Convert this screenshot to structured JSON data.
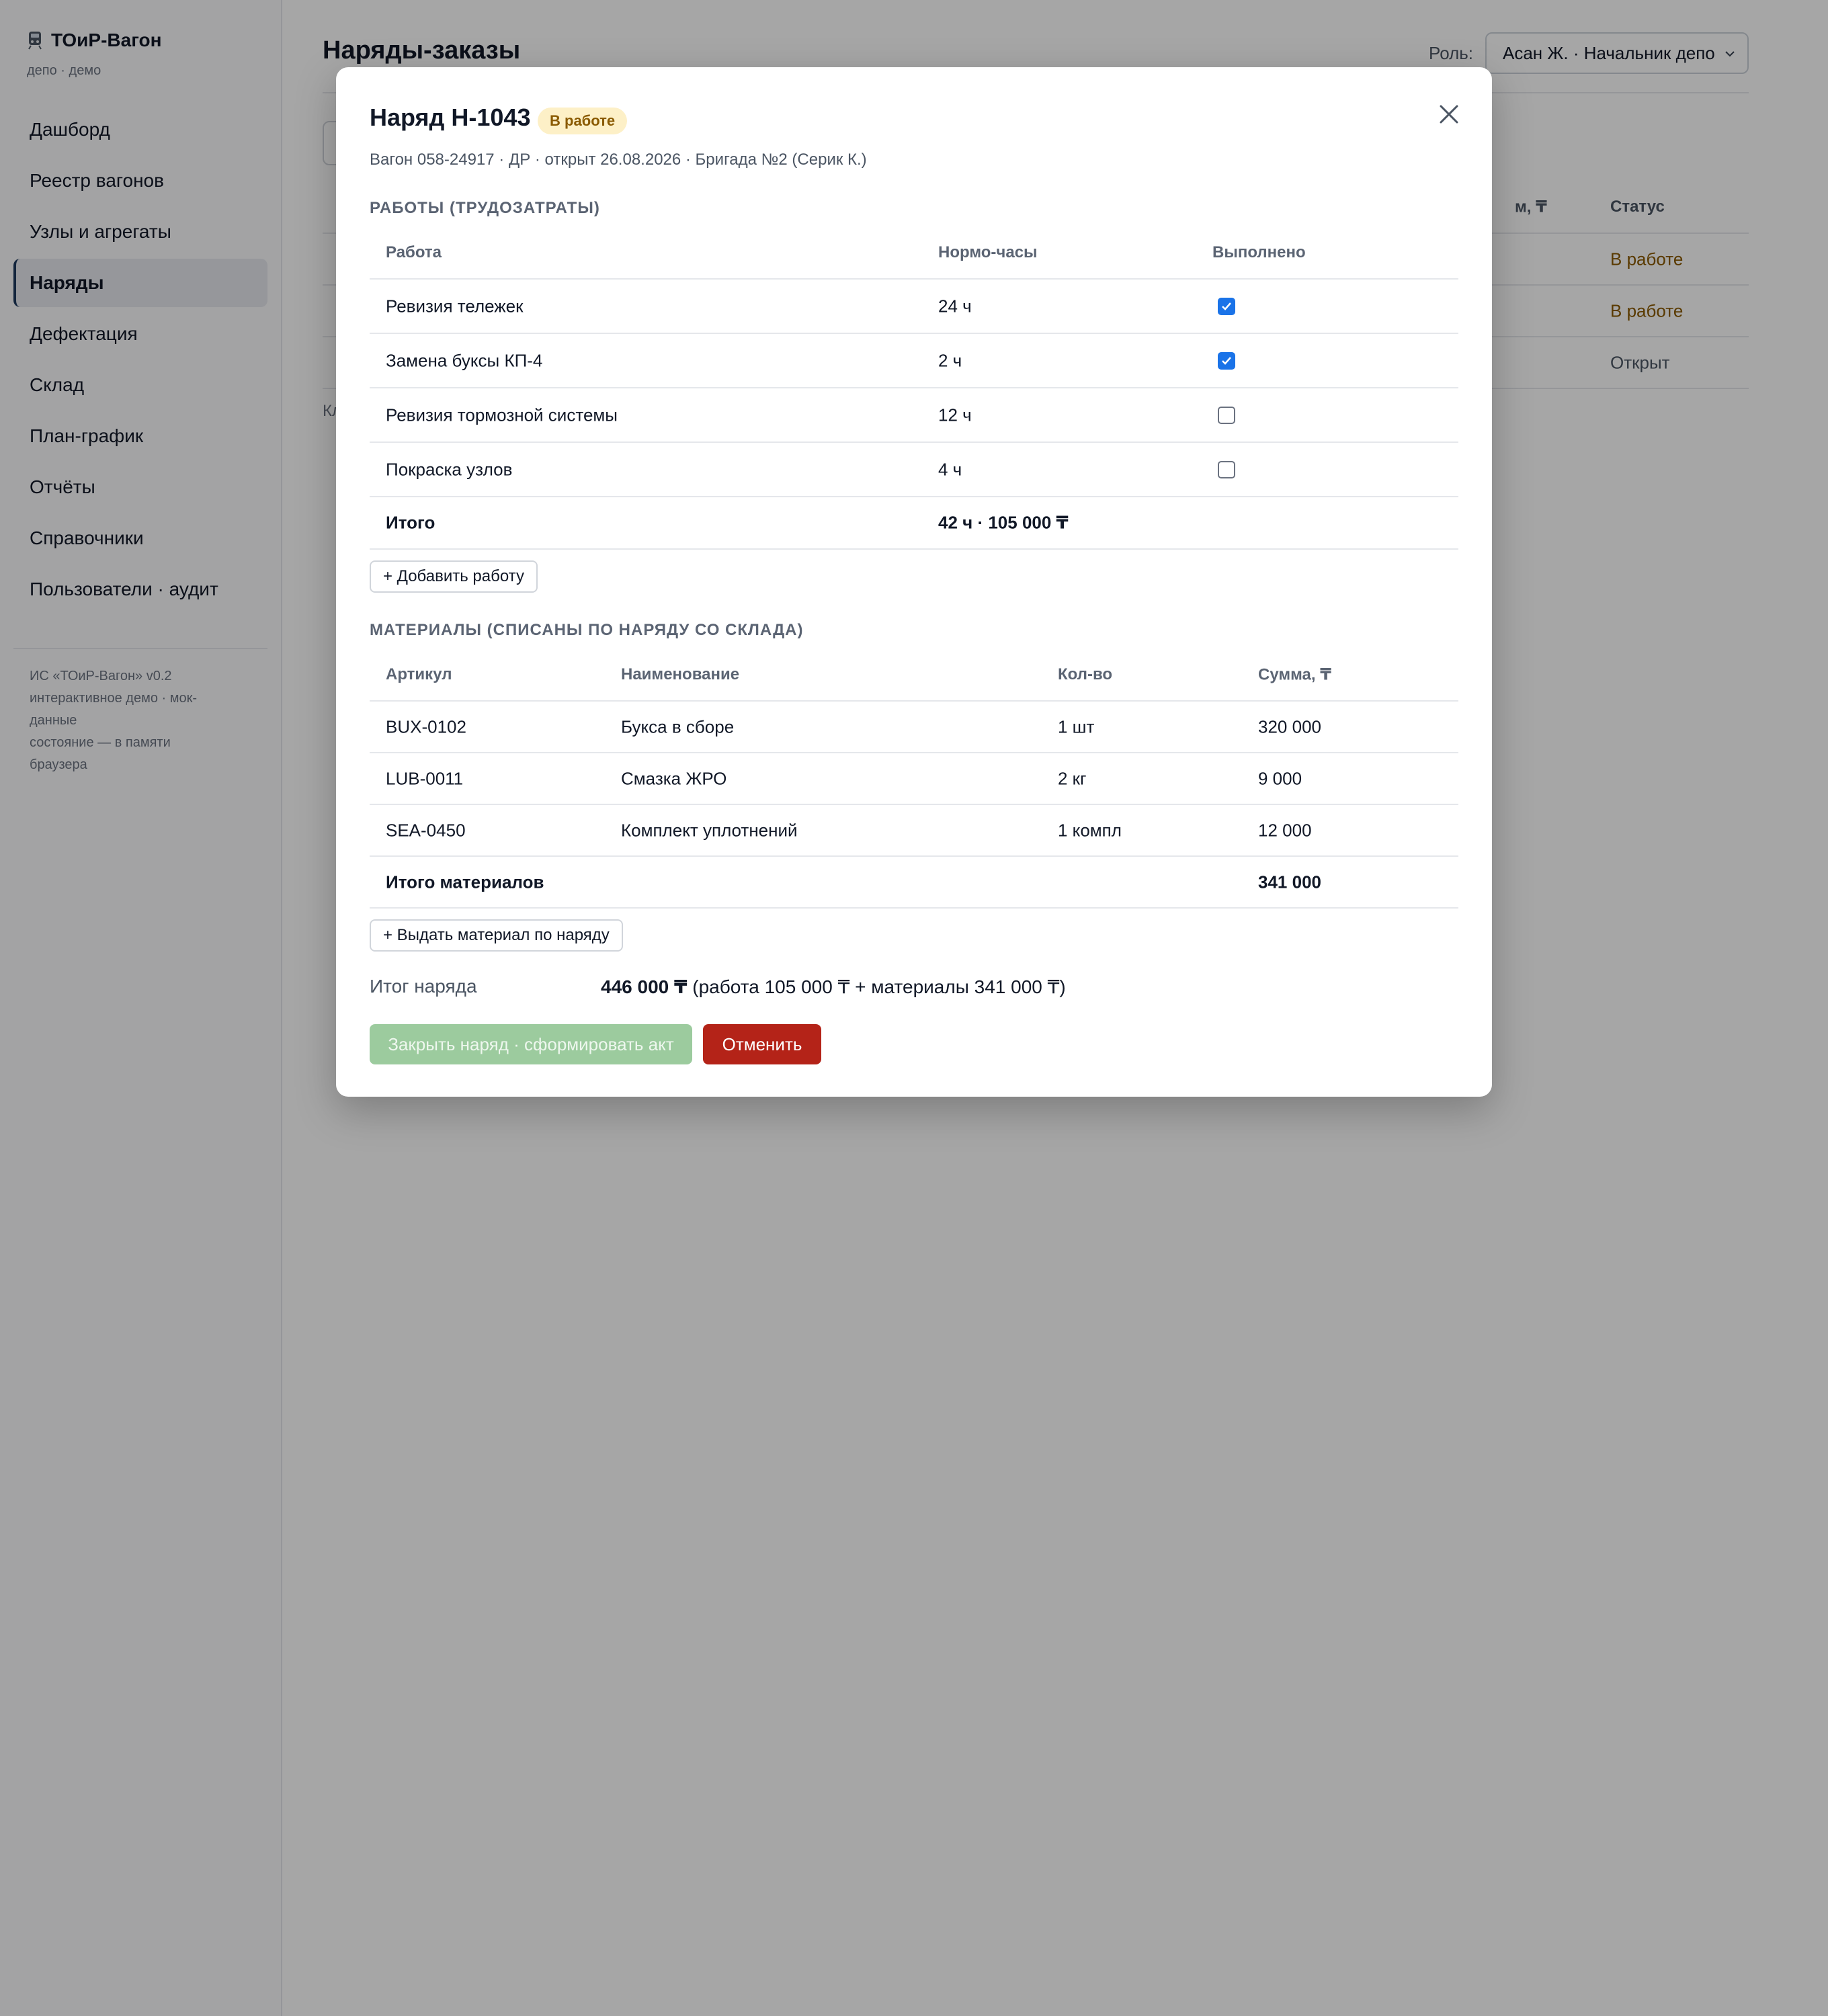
{
  "app": {
    "title": "ТОиР-Вагон",
    "subtitle": "депо · демо"
  },
  "sidebar": {
    "items": [
      {
        "label": "Дашборд",
        "active": false
      },
      {
        "label": "Реестр вагонов",
        "active": false
      },
      {
        "label": "Узлы и агрегаты",
        "active": false
      },
      {
        "label": "Наряды",
        "active": true
      },
      {
        "label": "Дефектация",
        "active": false
      },
      {
        "label": "Склад",
        "active": false
      },
      {
        "label": "План-график",
        "active": false
      },
      {
        "label": "Отчёты",
        "active": false
      },
      {
        "label": "Справочники",
        "active": false
      },
      {
        "label": "Пользователи · аудит",
        "active": false
      }
    ],
    "footer_lines": [
      "ИС «ТОиР-Вагон» v0.2",
      "интерактивное демо · мок-",
      "данные",
      "состояние — в памяти",
      "браузера"
    ]
  },
  "header": {
    "page_title": "Наряды-заказы",
    "role_label": "Роль:",
    "role_value": "Асан Ж. · Начальник депо"
  },
  "background_table": {
    "headers": {
      "sum_partial": "м, ₸",
      "status": "Статус"
    },
    "statuses": [
      "В работе",
      "В работе",
      "Открыт"
    ],
    "status_colors": {
      "in_progress": "#8a5a00",
      "open": "#4b5563"
    },
    "footnote_partial": "Кл"
  },
  "modal": {
    "title": "Наряд Н-1043",
    "status_badge": "В работе",
    "subtitle": "Вагон 058-24917 · ДР · открыт 26.08.2026 · Бригада №2 (Серик К.)",
    "works": {
      "section_title": "РАБОТЫ (ТРУДОЗАТРАТЫ)",
      "columns": [
        "Работа",
        "Нормо-часы",
        "Выполнено"
      ],
      "rows": [
        {
          "name": "Ревизия тележек",
          "hours": "24 ч",
          "done": true
        },
        {
          "name": "Замена буксы КП-4",
          "hours": "2 ч",
          "done": true
        },
        {
          "name": "Ревизия тормозной системы",
          "hours": "12 ч",
          "done": false
        },
        {
          "name": "Покраска узлов",
          "hours": "4 ч",
          "done": false
        }
      ],
      "total_label": "Итого",
      "total_value": "42 ч · 105 000 ₸",
      "add_button": "+ Добавить работу"
    },
    "materials": {
      "section_title": "МАТЕРИАЛЫ (СПИСАНЫ ПО НАРЯДУ СО СКЛАДА)",
      "columns": [
        "Артикул",
        "Наименование",
        "Кол-во",
        "Сумма, ₸"
      ],
      "rows": [
        {
          "sku": "BUX-0102",
          "name": "Букса в сборе",
          "qty": "1 шт",
          "sum": "320 000"
        },
        {
          "sku": "LUB-0011",
          "name": "Смазка ЖРО",
          "qty": "2 кг",
          "sum": "9 000"
        },
        {
          "sku": "SEA-0450",
          "name": "Комплект уплотнений",
          "qty": "1 компл",
          "sum": "12 000"
        }
      ],
      "total_label": "Итого материалов",
      "total_value": "341 000",
      "add_button": "+ Выдать материал по наряду"
    },
    "order_total": {
      "label": "Итог наряда",
      "value_bold": "446 000 ₸",
      "value_detail": " (работа 105 000 ₸ + материалы 341 000 ₸)"
    },
    "buttons": {
      "close_order": "Закрыть наряд · сформировать акт",
      "cancel": "Отменить"
    }
  },
  "colors": {
    "accent_blue": "#1a73e8",
    "badge_bg": "#fdf0c7",
    "badge_text": "#8a5a00",
    "success_disabled": "#9ccb9e",
    "danger": "#b42318"
  }
}
